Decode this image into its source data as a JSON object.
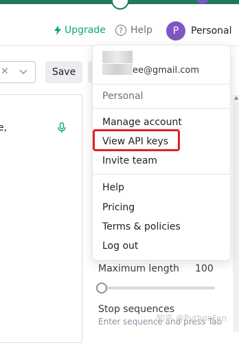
{
  "header": {
    "upgrade_label": "Upgrade",
    "help_label": "Help",
    "help_icon_glyph": "?",
    "account_initial": "P",
    "account_name": "Personal"
  },
  "toolbar": {
    "clear_glyph": "✕",
    "save_label": "Save"
  },
  "editor": {
    "text": "e,"
  },
  "menu": {
    "email": "ee@gmail.com",
    "organization": "Personal",
    "items_group1": [
      "Manage account",
      "View API keys",
      "Invite team"
    ],
    "items_group2": [
      "Help",
      "Pricing",
      "Terms & policies",
      "Log out"
    ]
  },
  "settings": {
    "max_length_label": "Maximum length",
    "max_length_value": "100",
    "stop_sequences_label": "Stop sequences",
    "stop_sequences_hint": "Enter sequence and press Tab"
  },
  "watermark": "知乎 @PythonFan",
  "colors": {
    "accent": "#10a37f",
    "avatar": "#7e57c2",
    "highlight": "#e01f1f"
  },
  "icons": [
    "bolt-icon",
    "help-circle-icon",
    "clear-icon",
    "chevron-down-icon",
    "microphone-icon"
  ]
}
